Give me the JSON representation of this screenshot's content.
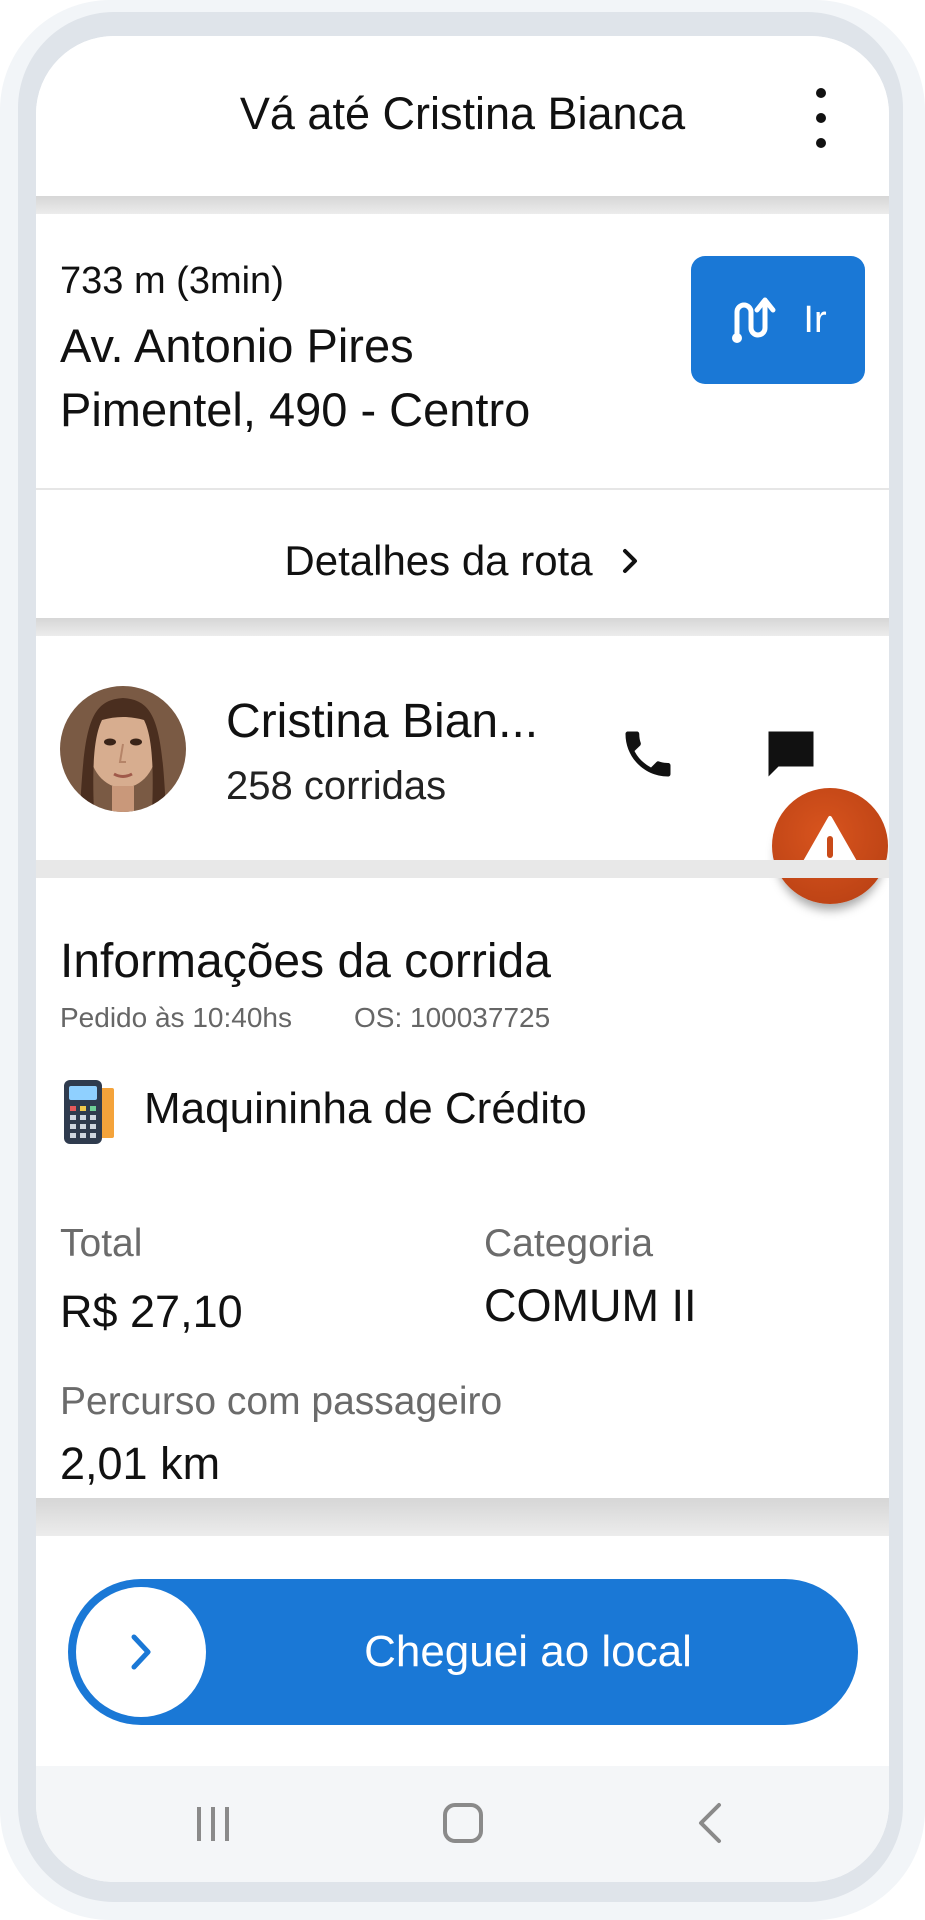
{
  "header": {
    "title": "Vá até Cristina Bianca",
    "menu_icon": "more-vertical-icon"
  },
  "route": {
    "distance_time": "733 m (3min)",
    "address_line1": "Av. Antonio Pires",
    "address_line2": "Pimentel, 490 - Centro",
    "go_button_label": "Ir",
    "go_button_icon": "route-icon",
    "details_label": "Detalhes da rota",
    "details_icon": "chevron-right-icon"
  },
  "passenger": {
    "name": "Cristina Bian...",
    "rides": "258 corridas",
    "call_icon": "phone-icon",
    "message_icon": "chat-icon",
    "alert_icon": "warning-icon"
  },
  "ride_info": {
    "title": "Informações da corrida",
    "ordered_at": "Pedido às 10:40hs",
    "os": "OS: 100037725",
    "payment_method": "Maquininha de Crédito",
    "payment_icon": "card-machine-icon",
    "total_label": "Total",
    "total_value": "R$ 27,10",
    "category_label": "Categoria",
    "category_value": "COMUM II",
    "distance_label": "Percurso com passageiro",
    "distance_value": "2,01 km"
  },
  "slider": {
    "label": "Cheguei ao local",
    "icon": "chevron-right-icon"
  },
  "navbar": {
    "recent_icon": "recent-apps-icon",
    "home_icon": "home-icon",
    "back_icon": "back-icon"
  },
  "colors": {
    "primary": "#1a78d6",
    "alert": "#c94a18",
    "separator": "#e3e3e3"
  }
}
